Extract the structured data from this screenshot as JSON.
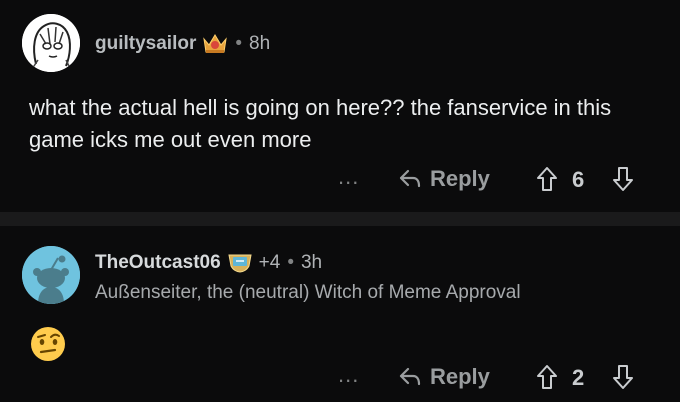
{
  "comments": [
    {
      "username": "guiltysailor",
      "flair_icon": "gold-crown-award-icon",
      "karma": "",
      "time": "8h",
      "subflair": "",
      "body": "what the actual hell is going on here?? the fanservice in this game icks me out even more",
      "emoji": "",
      "more": "...",
      "reply_label": "Reply",
      "votes": "6"
    },
    {
      "username": "TheOutcast06",
      "flair_icon": "blue-trophy-award-icon",
      "karma": "+4",
      "time": "3h",
      "subflair": "Außenseiter, the (neutral) Witch of Meme Approval",
      "body": "",
      "emoji": "raised-eyebrow-emoji",
      "more": "...",
      "reply_label": "Reply",
      "votes": "2"
    }
  ],
  "separator_dot": "•",
  "colors": {
    "background": "#0b0b0c",
    "divider": "#1a1a1b",
    "text_primary": "#eceeef",
    "text_muted": "#818384",
    "default_avatar": "#6fc3df"
  }
}
